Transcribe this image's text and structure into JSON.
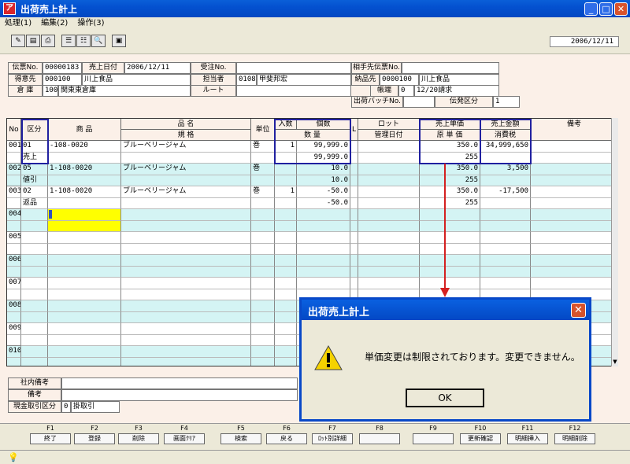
{
  "window": {
    "title": "出荷売上計上"
  },
  "menu": [
    "処理(1)",
    "編集(2)",
    "操作(3)"
  ],
  "toolbar": {
    "date": "2006/12/11"
  },
  "header": {
    "labels": {
      "slip_no": "伝票No.",
      "sales_date": "売上日付",
      "order_no": "受注No.",
      "partner_slip": "相手先伝票No.",
      "customer": "得意先",
      "person": "担当者",
      "ship_to": "納品先",
      "warehouse": "倉 庫",
      "route": "ルート",
      "account": "帳端",
      "batch": "出荷バッチNo.",
      "issue_class": "伝発区分"
    },
    "values": {
      "slip_no": "00000183",
      "sales_date": "2006/12/11",
      "customer_code": "000100",
      "customer_name": "川上食品",
      "person_code": "0108",
      "person_name": "甲斐邦宏",
      "ship_to_code": "0000100",
      "ship_to_name": "川上食品",
      "warehouse_code": "100",
      "warehouse_name": "関東東倉庫",
      "account_code": "0",
      "account_name": "12/20請求",
      "issue_class": "1"
    }
  },
  "grid": {
    "headers": {
      "no": "No",
      "kubun": "区分",
      "shohin": "商 品",
      "hinmei": "品 名",
      "kikaku": "規 格",
      "tani": "単位",
      "irisu": "入数",
      "kosu": "個数",
      "suryo": "数 量",
      "l": "L",
      "lot": "ロット",
      "kanri": "管理日付",
      "tanka": "売上単価",
      "gentanka": "原 単 価",
      "kingaku": "売上金額",
      "shohizei": "消費税",
      "biko": "備考"
    },
    "rows": [
      {
        "no": "001",
        "kubun_code": "01",
        "kubun_name": "売上",
        "code": "-108-0020",
        "name": "ブルーベリージャム",
        "unit": "巻",
        "irisu": "1",
        "kosu": "99,999.0",
        "suryo": "99,999.0",
        "tanka": "350.0",
        "gentanka": "255",
        "kingaku": "34,999,650",
        "zei": ""
      },
      {
        "no": "002",
        "kubun_code": "05",
        "kubun_name": "値引",
        "code": "1-108-0020",
        "name": "ブルーベリージャム",
        "unit": "巻",
        "irisu": "",
        "kosu": "10.0",
        "suryo": "10.0",
        "tanka": "350.0",
        "gentanka": "255",
        "kingaku": "3,500",
        "zei": ""
      },
      {
        "no": "003",
        "kubun_code": "02",
        "kubun_name": "返品",
        "code": "1-108-0020",
        "name": "ブルーベリージャム",
        "unit": "巻",
        "irisu": "1",
        "kosu": "-50.0",
        "suryo": "-50.0",
        "tanka": "350.0",
        "gentanka": "255",
        "kingaku": "-17,500",
        "zei": ""
      },
      {
        "no": "004"
      },
      {
        "no": "005"
      },
      {
        "no": "006"
      },
      {
        "no": "007"
      },
      {
        "no": "008"
      },
      {
        "no": "009"
      },
      {
        "no": "010"
      }
    ]
  },
  "footer": {
    "labels": {
      "memo": "社内備考",
      "biko": "備考",
      "cash": "現金取引区分"
    },
    "cash_code": "0",
    "cash_name": "掛取引"
  },
  "fkeys": [
    {
      "key": "F1",
      "label": "終了"
    },
    {
      "key": "F2",
      "label": "登録"
    },
    {
      "key": "F3",
      "label": "削除"
    },
    {
      "key": "F4",
      "label": "画面ｸﾘｱ"
    },
    {
      "key": "F5",
      "label": "検索"
    },
    {
      "key": "F6",
      "label": "戻る"
    },
    {
      "key": "F7",
      "label": "ﾛｯﾄ別詳細"
    },
    {
      "key": "F8",
      "label": ""
    },
    {
      "key": "F9",
      "label": ""
    },
    {
      "key": "F10",
      "label": "更新確認"
    },
    {
      "key": "F11",
      "label": "明細挿入"
    },
    {
      "key": "F12",
      "label": "明細削除"
    }
  ],
  "dialog": {
    "title": "出荷売上計上",
    "message": "単価変更は制限されております。変更できません。",
    "ok": "OK"
  },
  "colors": {
    "highlight": "#2020a0",
    "arrow": "#d42020",
    "selected": "#ffff00",
    "row_alt": "#d4f4f4"
  }
}
